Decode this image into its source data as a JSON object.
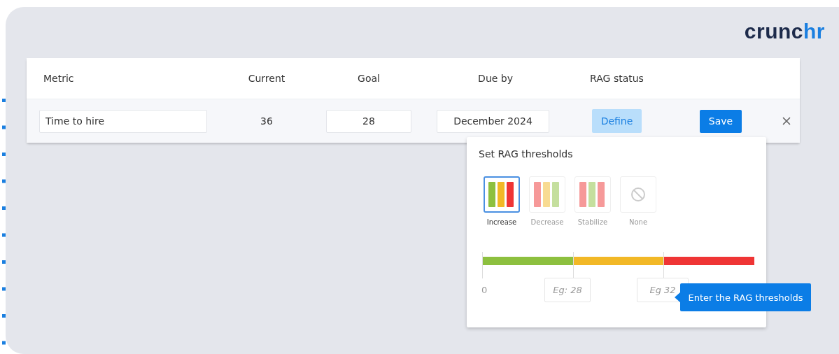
{
  "logo": {
    "main": "crunc",
    "accent": "hr"
  },
  "table": {
    "columns": [
      "Metric",
      "Current",
      "Goal",
      "Due by",
      "RAG status"
    ],
    "row": {
      "metric": "Time to hire",
      "current": "36",
      "goal": "28",
      "due_by": "December 2024",
      "define": "Define",
      "save": "Save"
    }
  },
  "popover": {
    "title": "Set RAG thresholds",
    "options": [
      {
        "kind": "increase",
        "label": "Increase",
        "selected": true
      },
      {
        "kind": "decrease",
        "label": "Decrease",
        "selected": false
      },
      {
        "kind": "stabilize",
        "label": "Stabilize",
        "selected": false
      },
      {
        "kind": "none",
        "label": "None",
        "selected": false
      }
    ],
    "segments": [
      {
        "color": "#8dc03f"
      },
      {
        "color": "#f2b827"
      },
      {
        "color": "#ef3535"
      }
    ],
    "start_label": "0",
    "thresholds": [
      {
        "placeholder": "Eg: 28"
      },
      {
        "placeholder": "Eg 32"
      }
    ],
    "tooltip": "Enter the RAG thresholds"
  }
}
